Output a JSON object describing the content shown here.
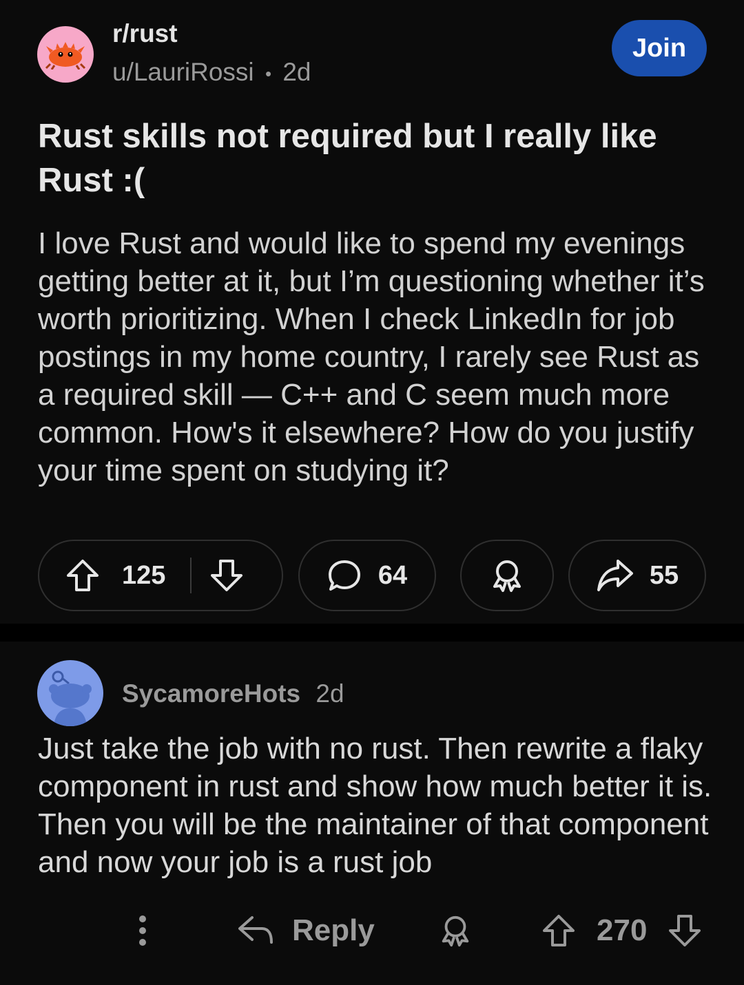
{
  "post": {
    "subreddit": "r/rust",
    "author": "u/LauriRossi",
    "separator": "•",
    "age": "2d",
    "join_label": "Join",
    "title": "Rust skills not required but I really like Rust :(",
    "body": "I love Rust and would like to spend my evenings getting better at it, but I’m questioning whether it’s worth prioritizing. When I check LinkedIn for job postings in my home country, I rarely see Rust as a required skill — C++ and C seem much more common. How's it elsewhere? How do you justify your time spent on studying it?",
    "upvotes": "125",
    "comments": "64",
    "shares": "55"
  },
  "comment": {
    "author": "SycamoreHots",
    "age": "2d",
    "body": "Just take the job with no rust.  Then rewrite a flaky component in rust and show how much better it is.  Then you will be the maintainer of that component and now your job is a rust job",
    "reply_label": "Reply",
    "score": "270"
  },
  "colors": {
    "background": "#0b0b0b",
    "join_button": "#1a4fae",
    "subreddit_avatar": "#f7a8c8",
    "user_avatar": "#7e9be8"
  },
  "icons": [
    "ferris-crab-icon",
    "upvote-icon",
    "downvote-icon",
    "comment-bubble-icon",
    "award-icon",
    "share-icon",
    "more-vertical-icon",
    "reply-arrow-icon",
    "snoo-avatar-icon"
  ]
}
